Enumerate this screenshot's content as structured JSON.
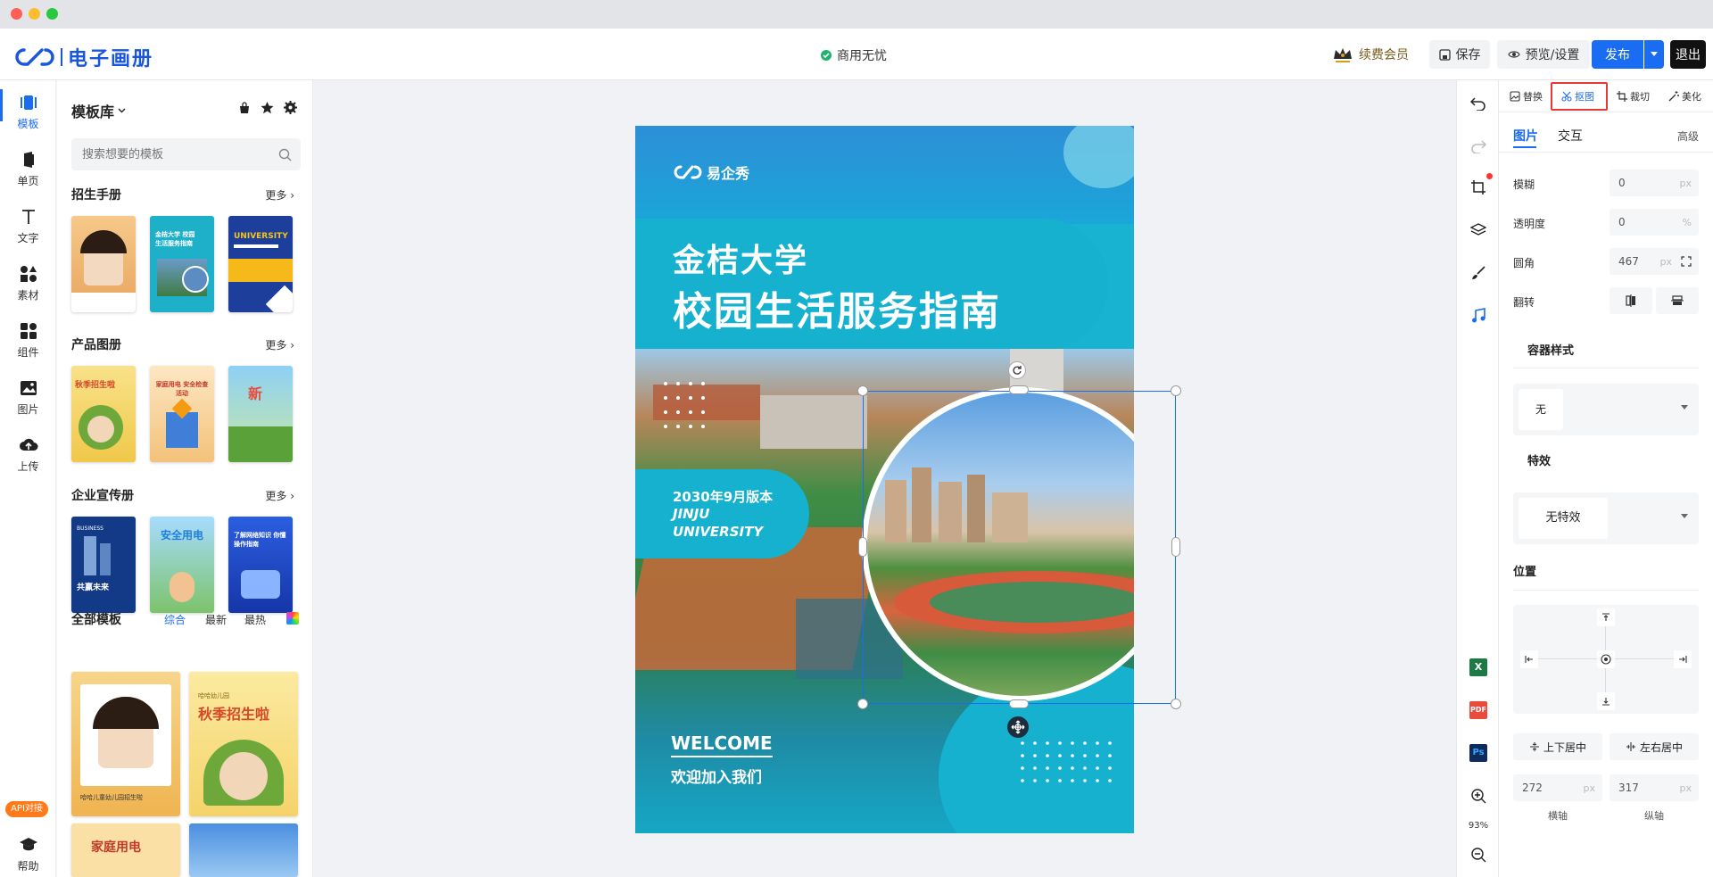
{
  "app": {
    "name": "电子画册",
    "status_text": "商用无忧"
  },
  "header": {
    "member_label": "续费会员",
    "save_label": "保存",
    "preview_label": "预览/设置",
    "publish_label": "发布",
    "exit_label": "退出"
  },
  "leftnav": {
    "items": [
      {
        "label": "模板",
        "icon": "template-icon"
      },
      {
        "label": "单页",
        "icon": "page-icon"
      },
      {
        "label": "文字",
        "icon": "text-icon"
      },
      {
        "label": "素材",
        "icon": "material-icon"
      },
      {
        "label": "组件",
        "icon": "component-icon"
      },
      {
        "label": "图片",
        "icon": "image-icon"
      },
      {
        "label": "上传",
        "icon": "upload-icon"
      }
    ],
    "api_badge": "API对接",
    "help_label": "帮助"
  },
  "panel": {
    "title": "模板库",
    "search_placeholder": "搜索想要的模板",
    "more_label": "更多",
    "sections": [
      {
        "title": "招生手册"
      },
      {
        "title": "产品图册"
      },
      {
        "title": "企业宣传册"
      }
    ],
    "all_title": "全部模板",
    "filters": [
      "综合",
      "最新",
      "最热"
    ],
    "thumb_texts": {
      "t2": "金桔大学 校园生活服务指南",
      "t3": "UNIVERSITY",
      "t4": "秋季招生啦",
      "t5": "家庭用电 安全检查活动",
      "t6": "新",
      "t7": "共赢未来",
      "t7b": "BUSINESS",
      "t8": "安全用电",
      "t9": "了解网络知识 你懂操作指南",
      "t10": "哈哈儿童幼儿园招生啦",
      "t11": "秋季招生啦",
      "t11b": "哈哈幼儿园",
      "t12": "家庭用电"
    }
  },
  "poster": {
    "brand": "易企秀",
    "title_line1": "金桔大学",
    "title_line2": "校园生活服务指南",
    "edition": "2030年9月版本",
    "uni_en_1": "JINJU",
    "uni_en_2": "UNIVERSITY",
    "welcome": "WELCOME",
    "welcome_cn": "欢迎加入我们"
  },
  "righttools": {
    "zoom": "93%"
  },
  "props": {
    "toolbar": [
      "替换",
      "抠图",
      "裁切",
      "美化"
    ],
    "tabs": [
      "图片",
      "交互"
    ],
    "advanced": "高级",
    "blur_label": "模糊",
    "blur_value": "0",
    "blur_unit": "px",
    "opacity_label": "透明度",
    "opacity_value": "0",
    "opacity_unit": "%",
    "radius_label": "圆角",
    "radius_value": "467",
    "radius_unit": "px",
    "flip_label": "翻转",
    "container_title": "容器样式",
    "container_value": "无",
    "effect_title": "特效",
    "effect_value": "无特效",
    "position_title": "位置",
    "vcenter_label": "上下居中",
    "hcenter_label": "左右居中",
    "x_value": "272",
    "y_value": "317",
    "x_unit": "px",
    "y_unit": "px",
    "x_label": "横轴",
    "y_label": "纵轴"
  }
}
